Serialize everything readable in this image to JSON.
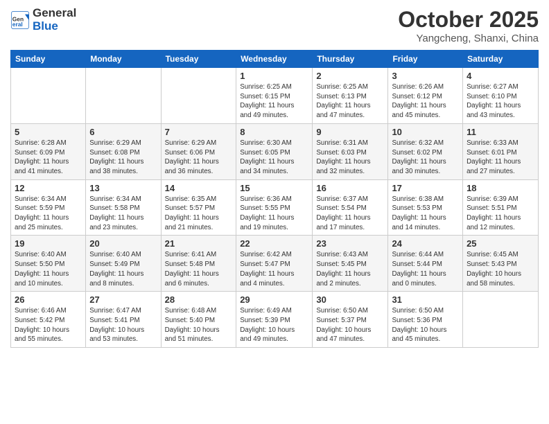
{
  "header": {
    "logo_line1": "General",
    "logo_line2": "Blue",
    "month_title": "October 2025",
    "location": "Yangcheng, Shanxi, China"
  },
  "weekdays": [
    "Sunday",
    "Monday",
    "Tuesday",
    "Wednesday",
    "Thursday",
    "Friday",
    "Saturday"
  ],
  "weeks": [
    [
      {
        "day": "",
        "info": ""
      },
      {
        "day": "",
        "info": ""
      },
      {
        "day": "",
        "info": ""
      },
      {
        "day": "1",
        "info": "Sunrise: 6:25 AM\nSunset: 6:15 PM\nDaylight: 11 hours\nand 49 minutes."
      },
      {
        "day": "2",
        "info": "Sunrise: 6:25 AM\nSunset: 6:13 PM\nDaylight: 11 hours\nand 47 minutes."
      },
      {
        "day": "3",
        "info": "Sunrise: 6:26 AM\nSunset: 6:12 PM\nDaylight: 11 hours\nand 45 minutes."
      },
      {
        "day": "4",
        "info": "Sunrise: 6:27 AM\nSunset: 6:10 PM\nDaylight: 11 hours\nand 43 minutes."
      }
    ],
    [
      {
        "day": "5",
        "info": "Sunrise: 6:28 AM\nSunset: 6:09 PM\nDaylight: 11 hours\nand 41 minutes."
      },
      {
        "day": "6",
        "info": "Sunrise: 6:29 AM\nSunset: 6:08 PM\nDaylight: 11 hours\nand 38 minutes."
      },
      {
        "day": "7",
        "info": "Sunrise: 6:29 AM\nSunset: 6:06 PM\nDaylight: 11 hours\nand 36 minutes."
      },
      {
        "day": "8",
        "info": "Sunrise: 6:30 AM\nSunset: 6:05 PM\nDaylight: 11 hours\nand 34 minutes."
      },
      {
        "day": "9",
        "info": "Sunrise: 6:31 AM\nSunset: 6:03 PM\nDaylight: 11 hours\nand 32 minutes."
      },
      {
        "day": "10",
        "info": "Sunrise: 6:32 AM\nSunset: 6:02 PM\nDaylight: 11 hours\nand 30 minutes."
      },
      {
        "day": "11",
        "info": "Sunrise: 6:33 AM\nSunset: 6:01 PM\nDaylight: 11 hours\nand 27 minutes."
      }
    ],
    [
      {
        "day": "12",
        "info": "Sunrise: 6:34 AM\nSunset: 5:59 PM\nDaylight: 11 hours\nand 25 minutes."
      },
      {
        "day": "13",
        "info": "Sunrise: 6:34 AM\nSunset: 5:58 PM\nDaylight: 11 hours\nand 23 minutes."
      },
      {
        "day": "14",
        "info": "Sunrise: 6:35 AM\nSunset: 5:57 PM\nDaylight: 11 hours\nand 21 minutes."
      },
      {
        "day": "15",
        "info": "Sunrise: 6:36 AM\nSunset: 5:55 PM\nDaylight: 11 hours\nand 19 minutes."
      },
      {
        "day": "16",
        "info": "Sunrise: 6:37 AM\nSunset: 5:54 PM\nDaylight: 11 hours\nand 17 minutes."
      },
      {
        "day": "17",
        "info": "Sunrise: 6:38 AM\nSunset: 5:53 PM\nDaylight: 11 hours\nand 14 minutes."
      },
      {
        "day": "18",
        "info": "Sunrise: 6:39 AM\nSunset: 5:51 PM\nDaylight: 11 hours\nand 12 minutes."
      }
    ],
    [
      {
        "day": "19",
        "info": "Sunrise: 6:40 AM\nSunset: 5:50 PM\nDaylight: 11 hours\nand 10 minutes."
      },
      {
        "day": "20",
        "info": "Sunrise: 6:40 AM\nSunset: 5:49 PM\nDaylight: 11 hours\nand 8 minutes."
      },
      {
        "day": "21",
        "info": "Sunrise: 6:41 AM\nSunset: 5:48 PM\nDaylight: 11 hours\nand 6 minutes."
      },
      {
        "day": "22",
        "info": "Sunrise: 6:42 AM\nSunset: 5:47 PM\nDaylight: 11 hours\nand 4 minutes."
      },
      {
        "day": "23",
        "info": "Sunrise: 6:43 AM\nSunset: 5:45 PM\nDaylight: 11 hours\nand 2 minutes."
      },
      {
        "day": "24",
        "info": "Sunrise: 6:44 AM\nSunset: 5:44 PM\nDaylight: 11 hours\nand 0 minutes."
      },
      {
        "day": "25",
        "info": "Sunrise: 6:45 AM\nSunset: 5:43 PM\nDaylight: 10 hours\nand 58 minutes."
      }
    ],
    [
      {
        "day": "26",
        "info": "Sunrise: 6:46 AM\nSunset: 5:42 PM\nDaylight: 10 hours\nand 55 minutes."
      },
      {
        "day": "27",
        "info": "Sunrise: 6:47 AM\nSunset: 5:41 PM\nDaylight: 10 hours\nand 53 minutes."
      },
      {
        "day": "28",
        "info": "Sunrise: 6:48 AM\nSunset: 5:40 PM\nDaylight: 10 hours\nand 51 minutes."
      },
      {
        "day": "29",
        "info": "Sunrise: 6:49 AM\nSunset: 5:39 PM\nDaylight: 10 hours\nand 49 minutes."
      },
      {
        "day": "30",
        "info": "Sunrise: 6:50 AM\nSunset: 5:37 PM\nDaylight: 10 hours\nand 47 minutes."
      },
      {
        "day": "31",
        "info": "Sunrise: 6:50 AM\nSunset: 5:36 PM\nDaylight: 10 hours\nand 45 minutes."
      },
      {
        "day": "",
        "info": ""
      }
    ]
  ],
  "shading": [
    false,
    true,
    false,
    true,
    false
  ]
}
